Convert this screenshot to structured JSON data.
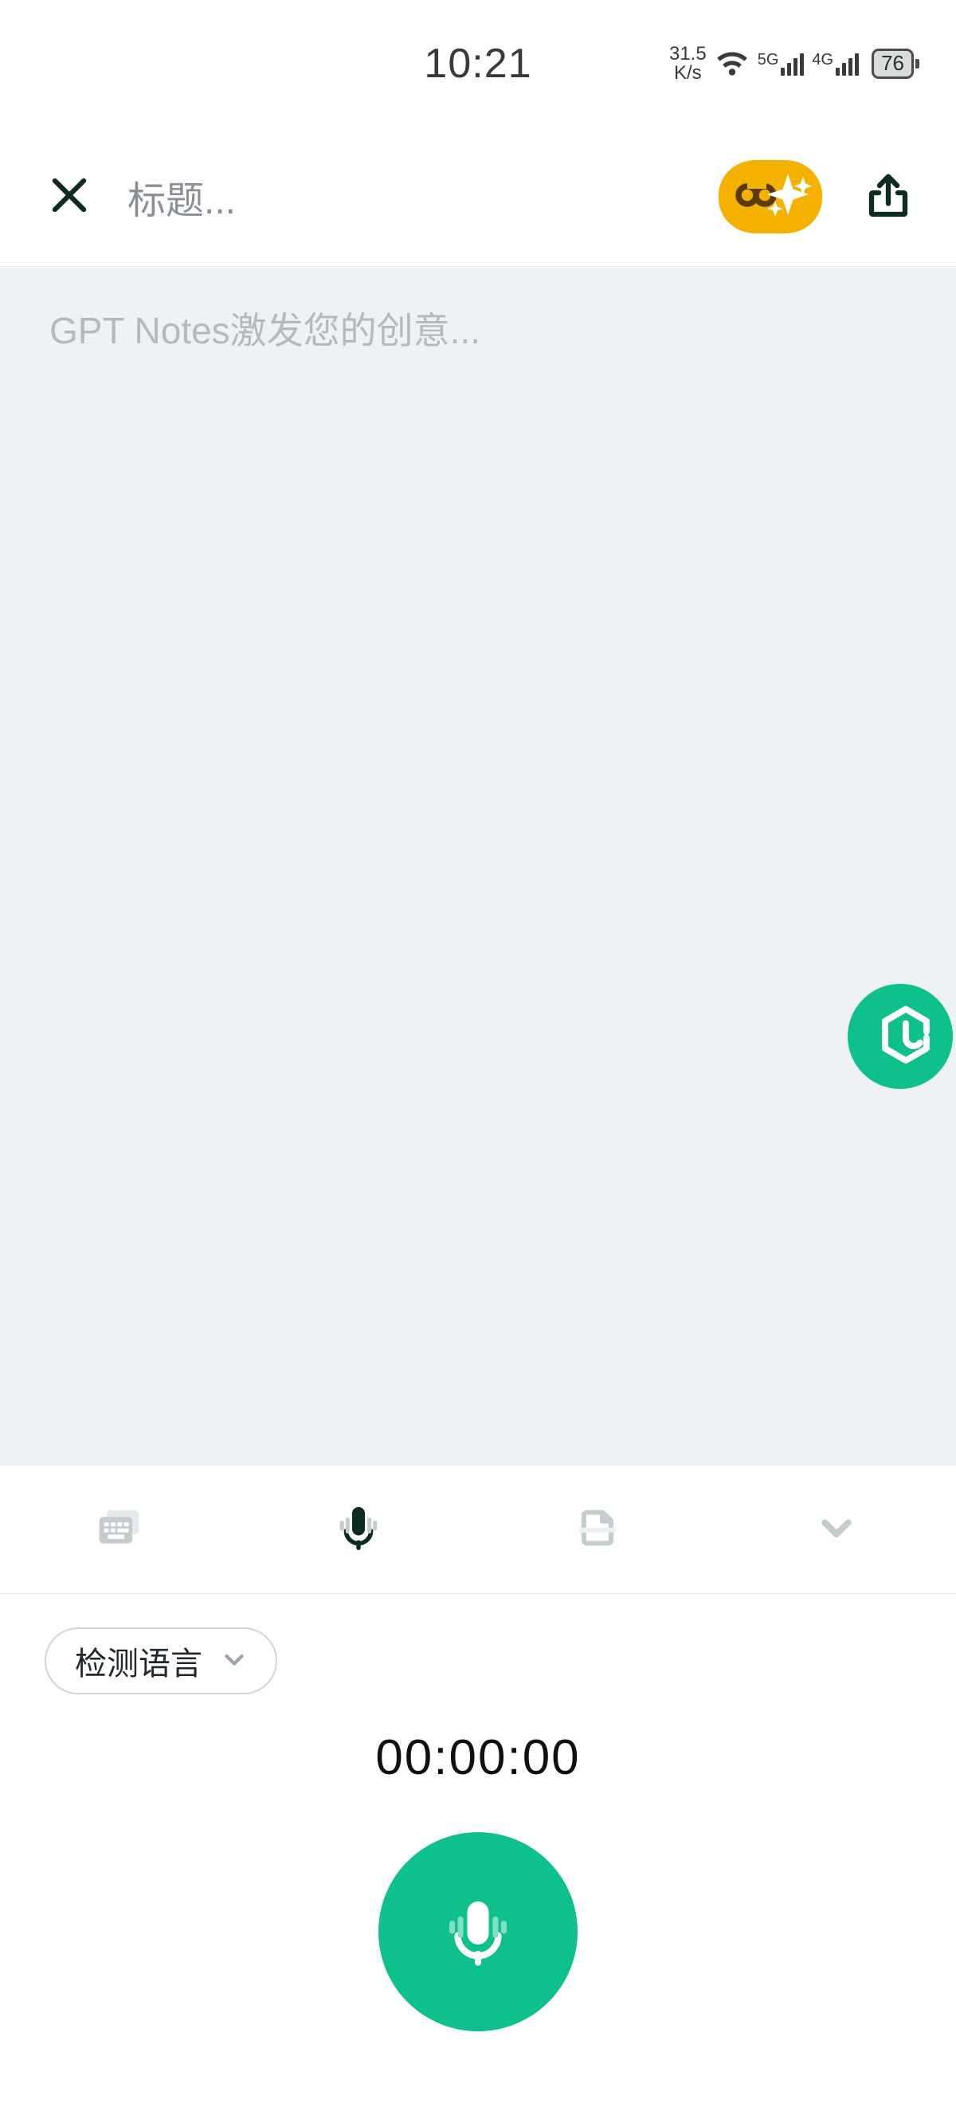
{
  "status_bar": {
    "time": "10:21",
    "net_speed_value": "31.5",
    "net_speed_unit": "K/s",
    "wifi_icon": "wifi-icon",
    "sim1_label": "5G",
    "sim2_label": "4G",
    "battery_level": "76"
  },
  "header": {
    "close_icon": "close-icon",
    "title_placeholder": "标题...",
    "ai_badge_icon": "ai-sparkle-infinity-icon",
    "share_icon": "share-icon"
  },
  "note": {
    "placeholder": "GPT Notes激发您的创意..."
  },
  "assistant_fab": {
    "icon": "hexagon-logo-icon"
  },
  "toolbar": {
    "items": [
      {
        "name": "keyboard-icon",
        "label": "keyboard",
        "active": false
      },
      {
        "name": "microphone-icon",
        "label": "microphone",
        "active": true
      },
      {
        "name": "scan-document-icon",
        "label": "scan",
        "active": false
      },
      {
        "name": "chevron-down-icon",
        "label": "collapse",
        "active": false
      }
    ]
  },
  "recorder": {
    "language_label": "检测语言",
    "language_chevron_icon": "chevron-down-icon",
    "timer": "00:00:00",
    "record_icon": "microphone-icon"
  },
  "colors": {
    "accent_green": "#0EC08C",
    "badge_amber": "#F5B100",
    "dark_ink": "#0E2B1F",
    "note_bg": "#EEF2F5",
    "muted_gray": "#C5CCCE"
  }
}
